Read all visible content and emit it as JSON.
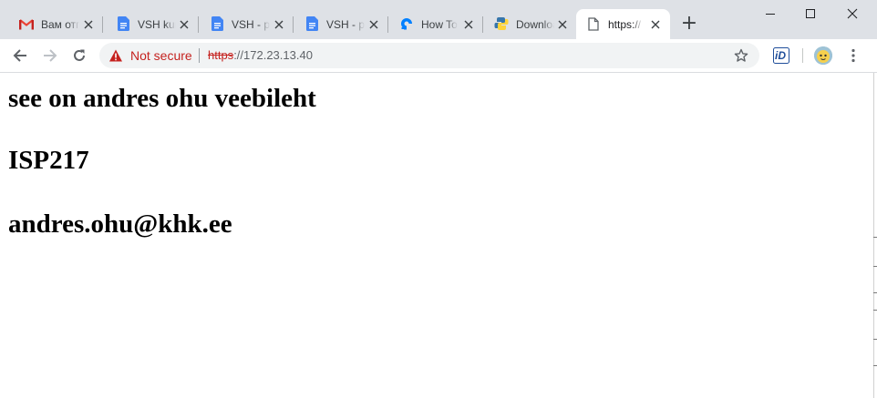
{
  "window": {
    "tabs": [
      {
        "title": "Вам отправлено сообщение",
        "favicon": "gmail-icon",
        "active": false
      },
      {
        "title": "VSH kursus",
        "favicon": "google-docs-icon",
        "active": false
      },
      {
        "title": "VSH - praktika",
        "favicon": "google-docs-icon",
        "active": false
      },
      {
        "title": "VSH - praktika",
        "favicon": "google-docs-icon",
        "active": false
      },
      {
        "title": "How To",
        "favicon": "digitalocean-icon",
        "active": false
      },
      {
        "title": "Download",
        "favicon": "python-icon",
        "active": false
      },
      {
        "title": "https://",
        "favicon": "page-icon",
        "active": true
      }
    ],
    "new_tab_symbol": "+"
  },
  "toolbar": {
    "security_label": "Not secure",
    "url_scheme": "https",
    "url_rest": "://172.23.13.40",
    "extension_label": "iD"
  },
  "page": {
    "heading1": "see on andres ohu veebileht",
    "heading2": "ISP217",
    "heading3": "andres.ohu@khk.ee"
  },
  "colors": {
    "tabstrip": "#dee1e6",
    "warning": "#c5221f",
    "omnibox": "#f1f3f4"
  }
}
